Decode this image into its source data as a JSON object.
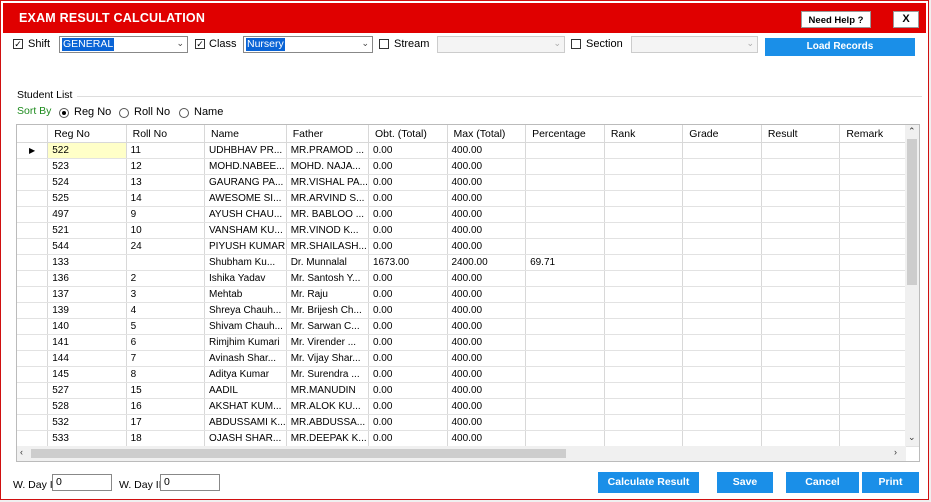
{
  "title": "EXAM RESULT CALCULATION",
  "help_label": "Need Help ?",
  "close_label": "X",
  "filters": {
    "shift_label": "Shift",
    "shift_value": "GENERAL",
    "class_label": "Class",
    "class_value": "Nursery",
    "stream_label": "Stream",
    "section_label": "Section",
    "check_mark": "✓"
  },
  "load_label": "Load Records",
  "student_list_label": "Student List",
  "sort": {
    "label": "Sort By",
    "options": [
      "Reg No",
      "Roll No",
      "Name"
    ],
    "selected": "Reg No"
  },
  "columns": [
    "Reg No",
    "Roll No",
    "Name",
    "Father",
    "Obt. (Total)",
    "Max (Total)",
    "Percentage",
    "Rank",
    "Grade",
    "Result",
    "Remark"
  ],
  "rows": [
    [
      "522",
      "11",
      "UDHBHAV PR...",
      "MR.PRAMOD ...",
      "0.00",
      "400.00",
      "",
      "",
      "",
      "",
      ""
    ],
    [
      "523",
      "12",
      "MOHD.NABEE...",
      "MOHD. NAJA...",
      "0.00",
      "400.00",
      "",
      "",
      "",
      "",
      ""
    ],
    [
      "524",
      "13",
      "GAURANG PA...",
      "MR.VISHAL PA...",
      "0.00",
      "400.00",
      "",
      "",
      "",
      "",
      ""
    ],
    [
      "525",
      "14",
      "AWESOME SI...",
      "MR.ARVIND S...",
      "0.00",
      "400.00",
      "",
      "",
      "",
      "",
      ""
    ],
    [
      "497",
      "9",
      "AYUSH CHAU...",
      "MR. BABLOO ...",
      "0.00",
      "400.00",
      "",
      "",
      "",
      "",
      ""
    ],
    [
      "521",
      "10",
      "VANSHAM KU...",
      "MR.VINOD K...",
      "0.00",
      "400.00",
      "",
      "",
      "",
      "",
      ""
    ],
    [
      "544",
      "24",
      "PIYUSH KUMAR",
      "MR.SHAILASH...",
      "0.00",
      "400.00",
      "",
      "",
      "",
      "",
      ""
    ],
    [
      "133",
      "",
      "Shubham Ku...",
      "Dr. Munnalal",
      "1673.00",
      "2400.00",
      "69.71",
      "",
      "",
      "",
      ""
    ],
    [
      "136",
      "2",
      "Ishika Yadav",
      "Mr. Santosh Y...",
      "0.00",
      "400.00",
      "",
      "",
      "",
      "",
      ""
    ],
    [
      "137",
      "3",
      "Mehtab",
      "Mr. Raju",
      "0.00",
      "400.00",
      "",
      "",
      "",
      "",
      ""
    ],
    [
      "139",
      "4",
      "Shreya Chauh...",
      "Mr. Brijesh Ch...",
      "0.00",
      "400.00",
      "",
      "",
      "",
      "",
      ""
    ],
    [
      "140",
      "5",
      "Shivam Chauh...",
      "Mr. Sarwan C...",
      "0.00",
      "400.00",
      "",
      "",
      "",
      "",
      ""
    ],
    [
      "141",
      "6",
      "Rimjhim Kumari",
      "Mr. Virender ...",
      "0.00",
      "400.00",
      "",
      "",
      "",
      "",
      ""
    ],
    [
      "144",
      "7",
      "Avinash Shar...",
      "Mr. Vijay Shar...",
      "0.00",
      "400.00",
      "",
      "",
      "",
      "",
      ""
    ],
    [
      "145",
      "8",
      "Aditya Kumar",
      "Mr. Surendra ...",
      "0.00",
      "400.00",
      "",
      "",
      "",
      "",
      ""
    ],
    [
      "527",
      "15",
      "AADIL",
      "MR.MANUDIN",
      "0.00",
      "400.00",
      "",
      "",
      "",
      "",
      ""
    ],
    [
      "528",
      "16",
      "AKSHAT KUM...",
      "MR.ALOK KU...",
      "0.00",
      "400.00",
      "",
      "",
      "",
      "",
      ""
    ],
    [
      "532",
      "17",
      "ABDUSSAMI K...",
      "MR.ABDUSSA...",
      "0.00",
      "400.00",
      "",
      "",
      "",
      "",
      ""
    ],
    [
      "533",
      "18",
      "OJASH SHAR...",
      "MR.DEEPAK K...",
      "0.00",
      "400.00",
      "",
      "",
      "",
      "",
      ""
    ]
  ],
  "selected_row_marker": "▶",
  "bottom": {
    "wday1_label": "W. Day I",
    "wday1_value": "0",
    "wday2_label": "W. Day II",
    "wday2_value": "0",
    "calculate_label": "Calculate Result",
    "save_label": "Save",
    "cancel_label": "Cancel",
    "print_label": "Print"
  },
  "colors": {
    "title_bar": "#e00000",
    "button": "#1a8fe8",
    "sort_label": "#1e8b1e",
    "selection": "#0a64d6"
  }
}
